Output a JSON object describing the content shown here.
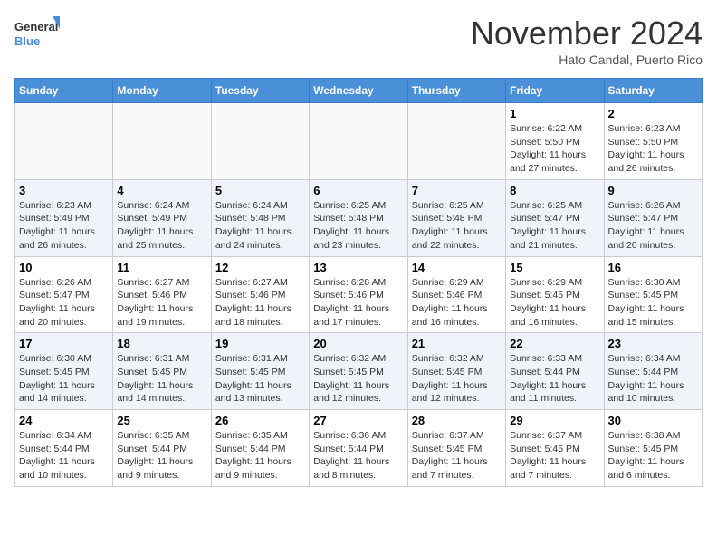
{
  "logo": {
    "line1": "General",
    "line2": "Blue"
  },
  "title": "November 2024",
  "subtitle": "Hato Candal, Puerto Rico",
  "days_of_week": [
    "Sunday",
    "Monday",
    "Tuesday",
    "Wednesday",
    "Thursday",
    "Friday",
    "Saturday"
  ],
  "weeks": [
    [
      {
        "num": "",
        "info": ""
      },
      {
        "num": "",
        "info": ""
      },
      {
        "num": "",
        "info": ""
      },
      {
        "num": "",
        "info": ""
      },
      {
        "num": "",
        "info": ""
      },
      {
        "num": "1",
        "info": "Sunrise: 6:22 AM\nSunset: 5:50 PM\nDaylight: 11 hours and 27 minutes."
      },
      {
        "num": "2",
        "info": "Sunrise: 6:23 AM\nSunset: 5:50 PM\nDaylight: 11 hours and 26 minutes."
      }
    ],
    [
      {
        "num": "3",
        "info": "Sunrise: 6:23 AM\nSunset: 5:49 PM\nDaylight: 11 hours and 26 minutes."
      },
      {
        "num": "4",
        "info": "Sunrise: 6:24 AM\nSunset: 5:49 PM\nDaylight: 11 hours and 25 minutes."
      },
      {
        "num": "5",
        "info": "Sunrise: 6:24 AM\nSunset: 5:48 PM\nDaylight: 11 hours and 24 minutes."
      },
      {
        "num": "6",
        "info": "Sunrise: 6:25 AM\nSunset: 5:48 PM\nDaylight: 11 hours and 23 minutes."
      },
      {
        "num": "7",
        "info": "Sunrise: 6:25 AM\nSunset: 5:48 PM\nDaylight: 11 hours and 22 minutes."
      },
      {
        "num": "8",
        "info": "Sunrise: 6:25 AM\nSunset: 5:47 PM\nDaylight: 11 hours and 21 minutes."
      },
      {
        "num": "9",
        "info": "Sunrise: 6:26 AM\nSunset: 5:47 PM\nDaylight: 11 hours and 20 minutes."
      }
    ],
    [
      {
        "num": "10",
        "info": "Sunrise: 6:26 AM\nSunset: 5:47 PM\nDaylight: 11 hours and 20 minutes."
      },
      {
        "num": "11",
        "info": "Sunrise: 6:27 AM\nSunset: 5:46 PM\nDaylight: 11 hours and 19 minutes."
      },
      {
        "num": "12",
        "info": "Sunrise: 6:27 AM\nSunset: 5:46 PM\nDaylight: 11 hours and 18 minutes."
      },
      {
        "num": "13",
        "info": "Sunrise: 6:28 AM\nSunset: 5:46 PM\nDaylight: 11 hours and 17 minutes."
      },
      {
        "num": "14",
        "info": "Sunrise: 6:29 AM\nSunset: 5:46 PM\nDaylight: 11 hours and 16 minutes."
      },
      {
        "num": "15",
        "info": "Sunrise: 6:29 AM\nSunset: 5:45 PM\nDaylight: 11 hours and 16 minutes."
      },
      {
        "num": "16",
        "info": "Sunrise: 6:30 AM\nSunset: 5:45 PM\nDaylight: 11 hours and 15 minutes."
      }
    ],
    [
      {
        "num": "17",
        "info": "Sunrise: 6:30 AM\nSunset: 5:45 PM\nDaylight: 11 hours and 14 minutes."
      },
      {
        "num": "18",
        "info": "Sunrise: 6:31 AM\nSunset: 5:45 PM\nDaylight: 11 hours and 14 minutes."
      },
      {
        "num": "19",
        "info": "Sunrise: 6:31 AM\nSunset: 5:45 PM\nDaylight: 11 hours and 13 minutes."
      },
      {
        "num": "20",
        "info": "Sunrise: 6:32 AM\nSunset: 5:45 PM\nDaylight: 11 hours and 12 minutes."
      },
      {
        "num": "21",
        "info": "Sunrise: 6:32 AM\nSunset: 5:45 PM\nDaylight: 11 hours and 12 minutes."
      },
      {
        "num": "22",
        "info": "Sunrise: 6:33 AM\nSunset: 5:44 PM\nDaylight: 11 hours and 11 minutes."
      },
      {
        "num": "23",
        "info": "Sunrise: 6:34 AM\nSunset: 5:44 PM\nDaylight: 11 hours and 10 minutes."
      }
    ],
    [
      {
        "num": "24",
        "info": "Sunrise: 6:34 AM\nSunset: 5:44 PM\nDaylight: 11 hours and 10 minutes."
      },
      {
        "num": "25",
        "info": "Sunrise: 6:35 AM\nSunset: 5:44 PM\nDaylight: 11 hours and 9 minutes."
      },
      {
        "num": "26",
        "info": "Sunrise: 6:35 AM\nSunset: 5:44 PM\nDaylight: 11 hours and 9 minutes."
      },
      {
        "num": "27",
        "info": "Sunrise: 6:36 AM\nSunset: 5:44 PM\nDaylight: 11 hours and 8 minutes."
      },
      {
        "num": "28",
        "info": "Sunrise: 6:37 AM\nSunset: 5:45 PM\nDaylight: 11 hours and 7 minutes."
      },
      {
        "num": "29",
        "info": "Sunrise: 6:37 AM\nSunset: 5:45 PM\nDaylight: 11 hours and 7 minutes."
      },
      {
        "num": "30",
        "info": "Sunrise: 6:38 AM\nSunset: 5:45 PM\nDaylight: 11 hours and 6 minutes."
      }
    ]
  ]
}
